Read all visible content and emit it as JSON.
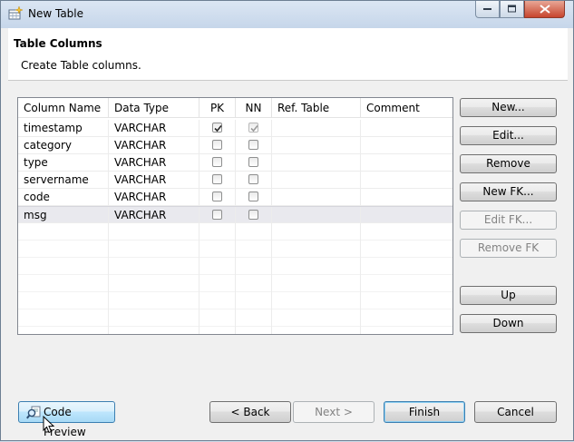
{
  "window": {
    "title": "New Table"
  },
  "header": {
    "title": "Table Columns",
    "description": "Create Table columns."
  },
  "table": {
    "columns": [
      "Column Name",
      "Data Type",
      "PK",
      "NN",
      "Ref. Table",
      "Comment"
    ],
    "rows": [
      {
        "name": "timestamp",
        "type": "VARCHAR",
        "pk": true,
        "nn": true
      },
      {
        "name": "category",
        "type": "VARCHAR",
        "pk": false,
        "nn": false
      },
      {
        "name": "type",
        "type": "VARCHAR",
        "pk": false,
        "nn": false
      },
      {
        "name": "servername",
        "type": "VARCHAR",
        "pk": false,
        "nn": false
      },
      {
        "name": "code",
        "type": "VARCHAR",
        "pk": false,
        "nn": false
      },
      {
        "name": "msg",
        "type": "VARCHAR",
        "pk": false,
        "nn": false
      }
    ]
  },
  "side_buttons": {
    "new": "New...",
    "edit": "Edit...",
    "remove": "Remove",
    "new_fk": "New FK...",
    "edit_fk": "Edit FK...",
    "remove_fk": "Remove FK",
    "up": "Up",
    "down": "Down"
  },
  "footer": {
    "code_preview": "Code Preview",
    "back": "< Back",
    "next": "Next >",
    "finish": "Finish",
    "cancel": "Cancel"
  }
}
